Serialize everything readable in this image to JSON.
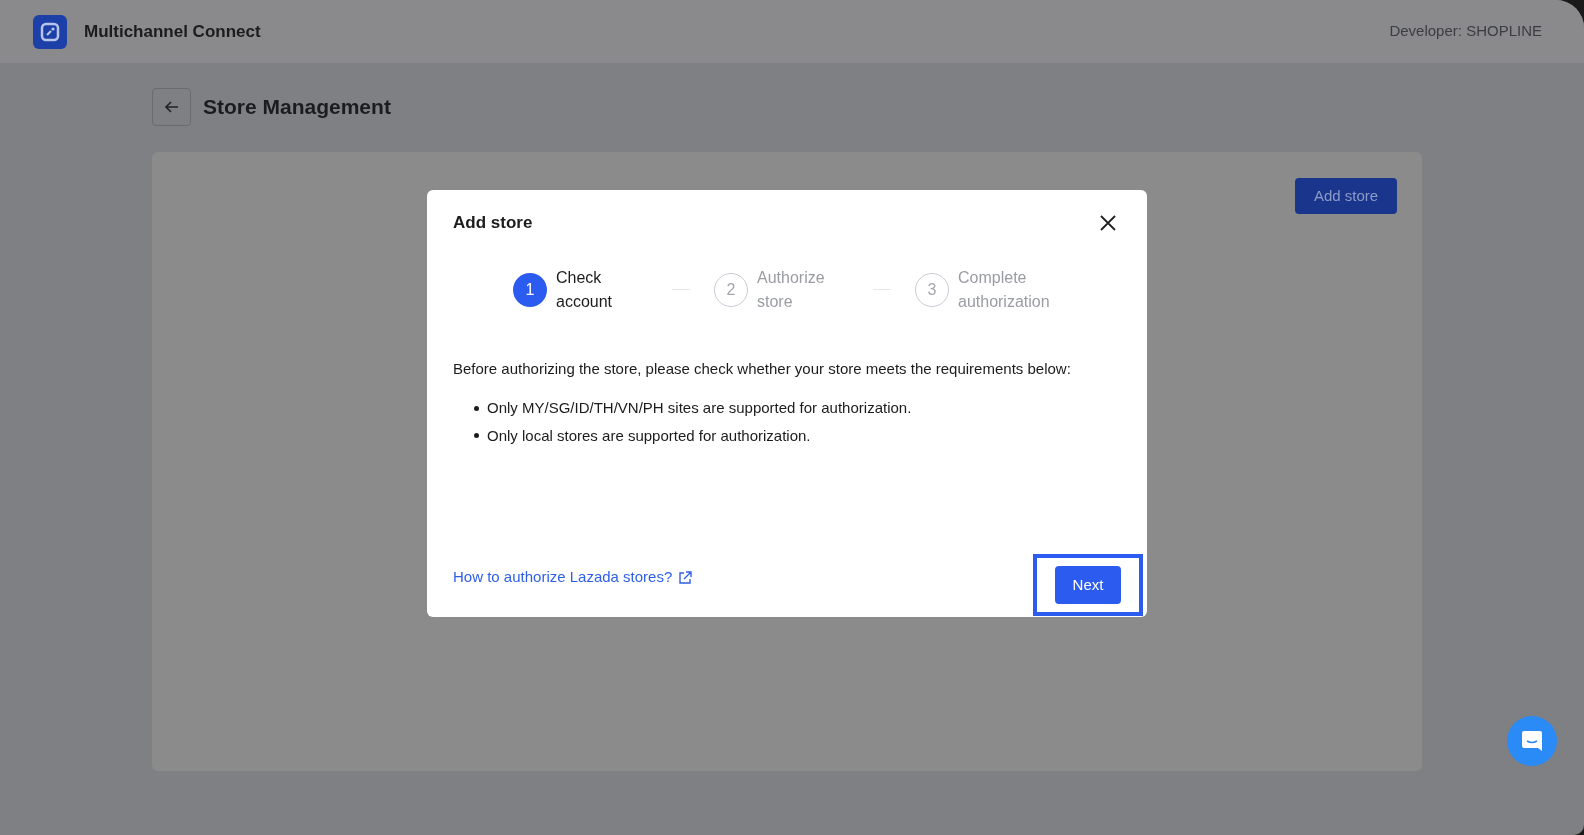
{
  "app": {
    "title": "Multichannel Connect",
    "developer": "Developer: SHOPLINE"
  },
  "page": {
    "title": "Store Management",
    "add_button": "Add store"
  },
  "modal": {
    "title": "Add store",
    "steps": [
      {
        "number": "1",
        "label": "Check account",
        "selected": true
      },
      {
        "number": "2",
        "label": "Authorize store",
        "selected": false
      },
      {
        "number": "3",
        "label": "Complete authorization",
        "selected": false
      }
    ],
    "intro": "Before authorizing the store, please check whether your store meets the requirements below:",
    "requirements": [
      "Only MY/SG/ID/TH/VN/PH sites are supported for authorization.",
      "Only local stores are supported for authorization."
    ],
    "help_link": "How to authorize Lazada stores?",
    "next_button": "Next",
    "next_highlighted": true
  }
}
